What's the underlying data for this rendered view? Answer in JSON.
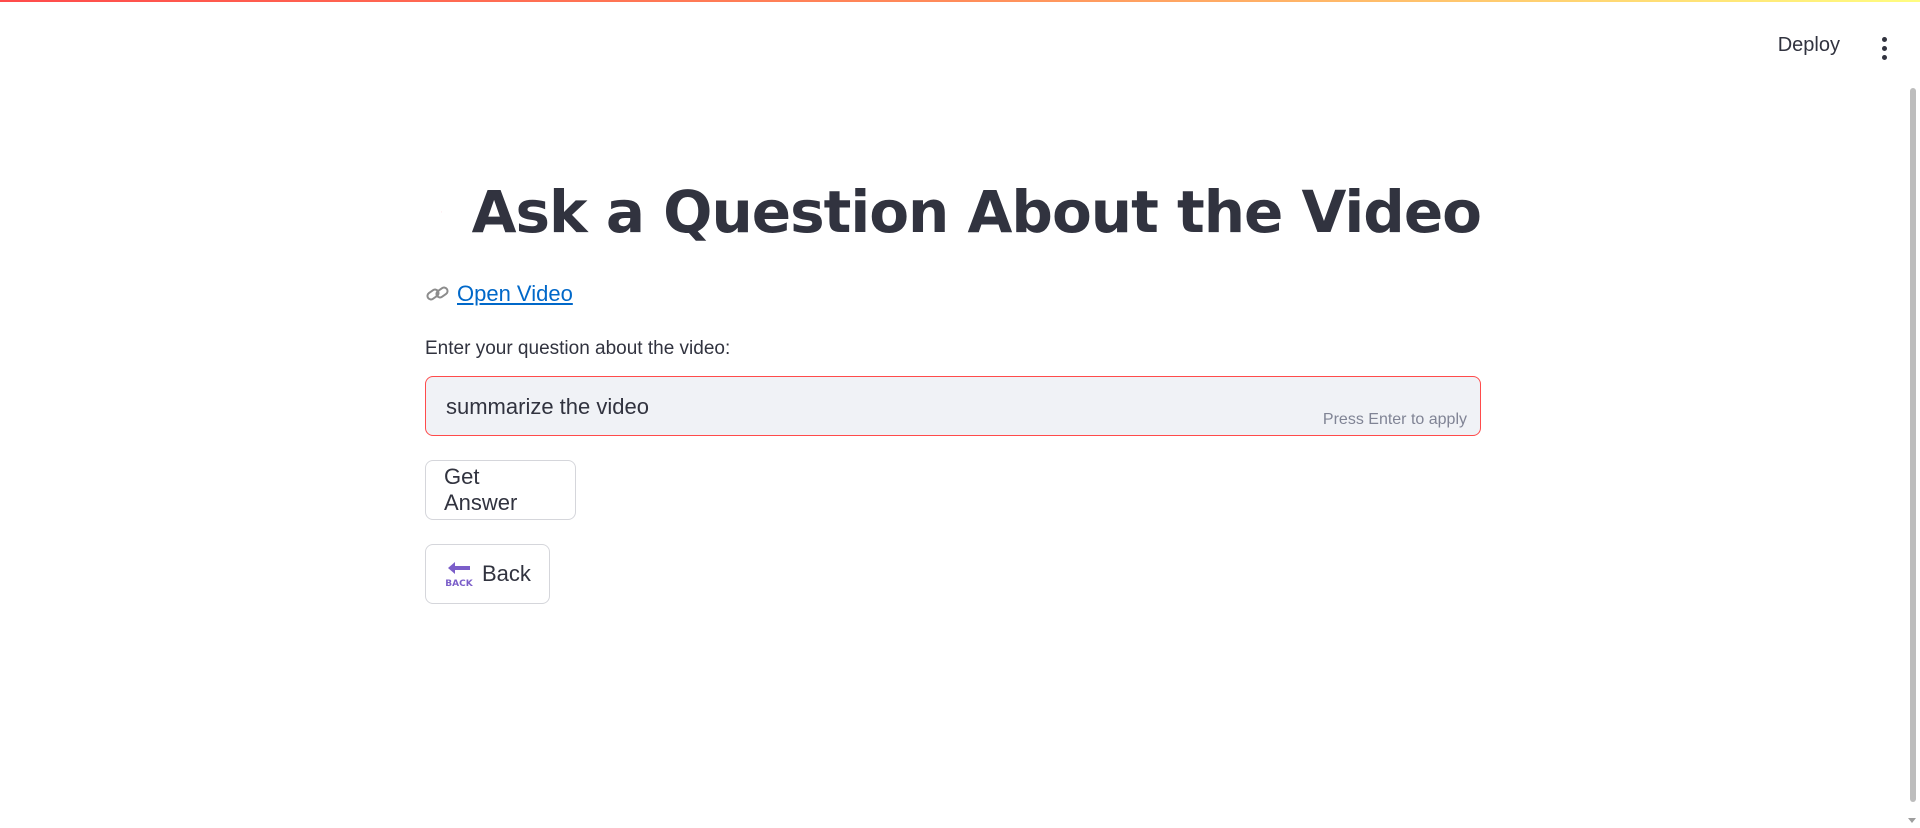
{
  "header": {
    "deploy_label": "Deploy",
    "menu_icon": "more-vertical-icon"
  },
  "page": {
    "title": "Ask a Question About the Video",
    "title_icon": "question-mark-icon",
    "link": {
      "icon": "link-icon",
      "label": "Open Video"
    },
    "question_field": {
      "label": "Enter your question about the video:",
      "value": "summarize the video",
      "hint": "Press Enter to apply"
    },
    "get_answer_label": "Get Answer",
    "back": {
      "icon": "back-arrow-icon",
      "icon_text": "BACK",
      "label": "Back"
    }
  },
  "colors": {
    "accent": "#ff4b4b",
    "link": "#0068c9",
    "text": "#31333f",
    "input_bg": "#f0f2f6",
    "hint": "#808495",
    "back_icon": "#7b5ec9"
  }
}
